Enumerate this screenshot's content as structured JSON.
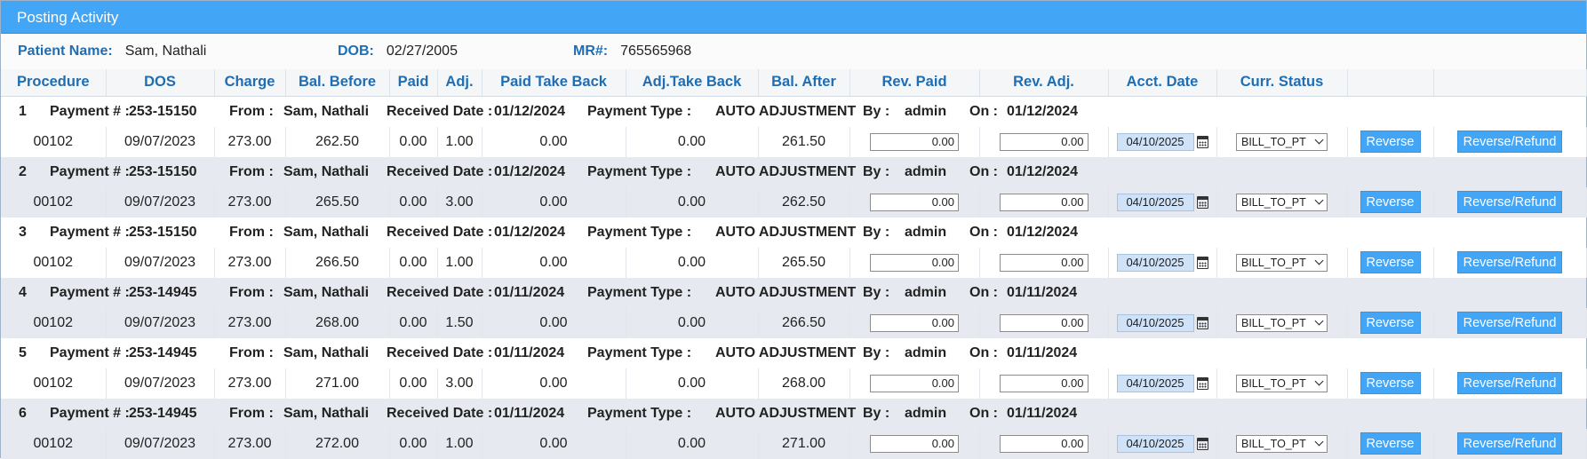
{
  "window": {
    "title": "Posting Activity"
  },
  "patient": {
    "name_label": "Patient Name:",
    "name": "Sam, Nathali",
    "dob_label": "DOB:",
    "dob": "02/27/2005",
    "mr_label": "MR#:",
    "mr": "765565968"
  },
  "columns": [
    "Procedure",
    "DOS",
    "Charge",
    "Bal. Before",
    "Paid",
    "Adj.",
    "Paid Take Back",
    "Adj.Take Back",
    "Bal. After",
    "Rev. Paid",
    "Rev. Adj.",
    "Acct. Date",
    "Curr. Status",
    "",
    ""
  ],
  "labels": {
    "payment": "Payment # :",
    "from": "From :",
    "received": "Received Date :",
    "type": "Payment Type :",
    "by": "By :",
    "on": "On :",
    "reverse": "Reverse",
    "refund": "Reverse/Refund"
  },
  "rows": [
    {
      "n": "1",
      "payment": "253-15150",
      "from": "Sam, Nathali",
      "received": "01/12/2024",
      "type": "AUTO ADJUSTMENT",
      "by": "admin",
      "on": "01/12/2024",
      "procedure": "00102",
      "dos": "09/07/2023",
      "charge": "273.00",
      "bal_before": "262.50",
      "paid": "0.00",
      "adj": "1.00",
      "paid_tb": "0.00",
      "adj_tb": "0.00",
      "bal_after": "261.50",
      "rev_paid": "0.00",
      "rev_adj": "0.00",
      "acct_date": "04/10/2025",
      "status": "BILL_TO_PT"
    },
    {
      "n": "2",
      "payment": "253-15150",
      "from": "Sam, Nathali",
      "received": "01/12/2024",
      "type": "AUTO ADJUSTMENT",
      "by": "admin",
      "on": "01/12/2024",
      "procedure": "00102",
      "dos": "09/07/2023",
      "charge": "273.00",
      "bal_before": "265.50",
      "paid": "0.00",
      "adj": "3.00",
      "paid_tb": "0.00",
      "adj_tb": "0.00",
      "bal_after": "262.50",
      "rev_paid": "0.00",
      "rev_adj": "0.00",
      "acct_date": "04/10/2025",
      "status": "BILL_TO_PT"
    },
    {
      "n": "3",
      "payment": "253-15150",
      "from": "Sam, Nathali",
      "received": "01/12/2024",
      "type": "AUTO ADJUSTMENT",
      "by": "admin",
      "on": "01/12/2024",
      "procedure": "00102",
      "dos": "09/07/2023",
      "charge": "273.00",
      "bal_before": "266.50",
      "paid": "0.00",
      "adj": "1.00",
      "paid_tb": "0.00",
      "adj_tb": "0.00",
      "bal_after": "265.50",
      "rev_paid": "0.00",
      "rev_adj": "0.00",
      "acct_date": "04/10/2025",
      "status": "BILL_TO_PT"
    },
    {
      "n": "4",
      "payment": "253-14945",
      "from": "Sam, Nathali",
      "received": "01/11/2024",
      "type": "AUTO ADJUSTMENT",
      "by": "admin",
      "on": "01/11/2024",
      "procedure": "00102",
      "dos": "09/07/2023",
      "charge": "273.00",
      "bal_before": "268.00",
      "paid": "0.00",
      "adj": "1.50",
      "paid_tb": "0.00",
      "adj_tb": "0.00",
      "bal_after": "266.50",
      "rev_paid": "0.00",
      "rev_adj": "0.00",
      "acct_date": "04/10/2025",
      "status": "BILL_TO_PT"
    },
    {
      "n": "5",
      "payment": "253-14945",
      "from": "Sam, Nathali",
      "received": "01/11/2024",
      "type": "AUTO ADJUSTMENT",
      "by": "admin",
      "on": "01/11/2024",
      "procedure": "00102",
      "dos": "09/07/2023",
      "charge": "273.00",
      "bal_before": "271.00",
      "paid": "0.00",
      "adj": "3.00",
      "paid_tb": "0.00",
      "adj_tb": "0.00",
      "bal_after": "268.00",
      "rev_paid": "0.00",
      "rev_adj": "0.00",
      "acct_date": "04/10/2025",
      "status": "BILL_TO_PT"
    },
    {
      "n": "6",
      "payment": "253-14945",
      "from": "Sam, Nathali",
      "received": "01/11/2024",
      "type": "AUTO ADJUSTMENT",
      "by": "admin",
      "on": "01/11/2024",
      "procedure": "00102",
      "dos": "09/07/2023",
      "charge": "273.00",
      "bal_before": "272.00",
      "paid": "0.00",
      "adj": "1.00",
      "paid_tb": "0.00",
      "adj_tb": "0.00",
      "bal_after": "271.00",
      "rev_paid": "0.00",
      "rev_adj": "0.00",
      "acct_date": "04/10/2025",
      "status": "BILL_TO_PT"
    }
  ]
}
